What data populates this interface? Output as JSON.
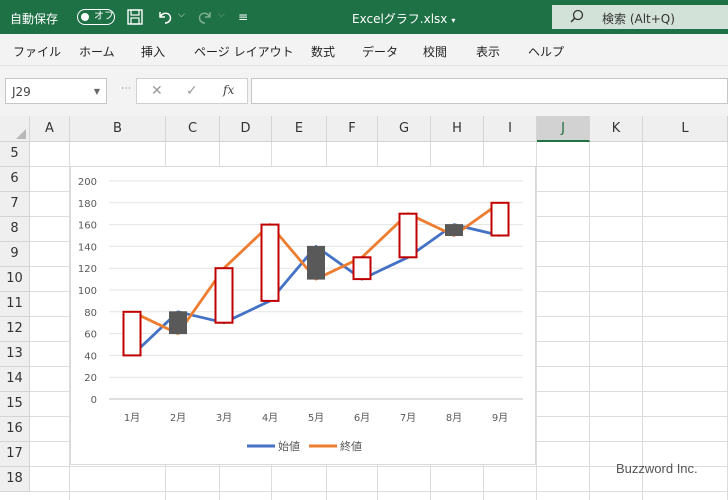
{
  "titlebar": {
    "autosave_label": "自動保存",
    "autosave_state": "オフ",
    "file_title": "Excelグラフ.xlsx",
    "search_text": "検索 (Alt+Q)"
  },
  "menu": [
    "ファイル",
    "ホーム",
    "挿入",
    "ページ レイアウト",
    "数式",
    "データ",
    "校閲",
    "表示",
    "ヘルプ"
  ],
  "formula_bar": {
    "name_box": "J29",
    "formula": ""
  },
  "sheet": {
    "columns": [
      "A",
      "B",
      "C",
      "D",
      "E",
      "F",
      "G",
      "H",
      "I",
      "J",
      "K",
      "L"
    ],
    "selected_column": "J",
    "rows": [
      "5",
      "6",
      "7",
      "8",
      "9",
      "10",
      "11",
      "12",
      "13",
      "14",
      "15",
      "16",
      "17",
      "18"
    ]
  },
  "chart_data": {
    "type": "line",
    "variant": "stock-open-close",
    "categories": [
      "1月",
      "2月",
      "3月",
      "4月",
      "5月",
      "6月",
      "7月",
      "8月",
      "9月"
    ],
    "series": [
      {
        "name": "始値",
        "values": [
          40,
          80,
          70,
          90,
          140,
          110,
          130,
          160,
          150
        ],
        "color": "#4472c4"
      },
      {
        "name": "終値",
        "values": [
          80,
          60,
          120,
          160,
          110,
          130,
          170,
          150,
          180
        ],
        "color": "#ed7d31"
      }
    ],
    "up_bar_color": "#c00000",
    "down_bar_color": "#595959",
    "ylim": [
      0,
      200
    ],
    "yticks": [
      0,
      20,
      40,
      60,
      80,
      100,
      120,
      140,
      160,
      180,
      200
    ],
    "grid": true,
    "legend": "bottom"
  },
  "watermark": "Buzzword Inc."
}
